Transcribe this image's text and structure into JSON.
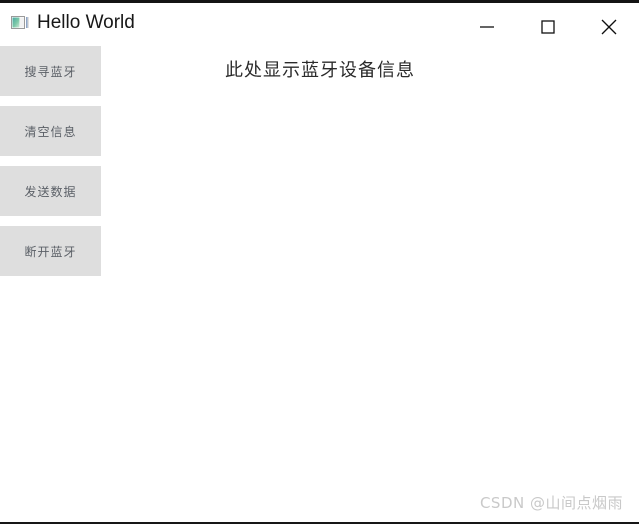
{
  "window": {
    "title": "Hello World",
    "icon": "app-window-image-icon",
    "controls": [
      {
        "name": "minimize",
        "glyph": "—",
        "label": "Minimize"
      },
      {
        "name": "maximize",
        "glyph": "▢",
        "label": "Maximize"
      },
      {
        "name": "close",
        "glyph": "✕",
        "label": "Close"
      }
    ]
  },
  "sidebar": {
    "buttons": [
      {
        "label": "搜寻蓝牙"
      },
      {
        "label": "清空信息"
      },
      {
        "label": "发送数据"
      },
      {
        "label": "断开蓝牙"
      }
    ]
  },
  "main": {
    "message": "此处显示蓝牙设备信息"
  },
  "watermark": {
    "text": "CSDN @山间点烟雨"
  },
  "colors": {
    "button_bg": "#dedede",
    "button_text": "#5a5f66",
    "title_text": "#181818",
    "content_text": "#2b2b2b",
    "watermark_text": "#c9c9c9",
    "window_border": "#141414",
    "page_bg": "#ffffff"
  }
}
